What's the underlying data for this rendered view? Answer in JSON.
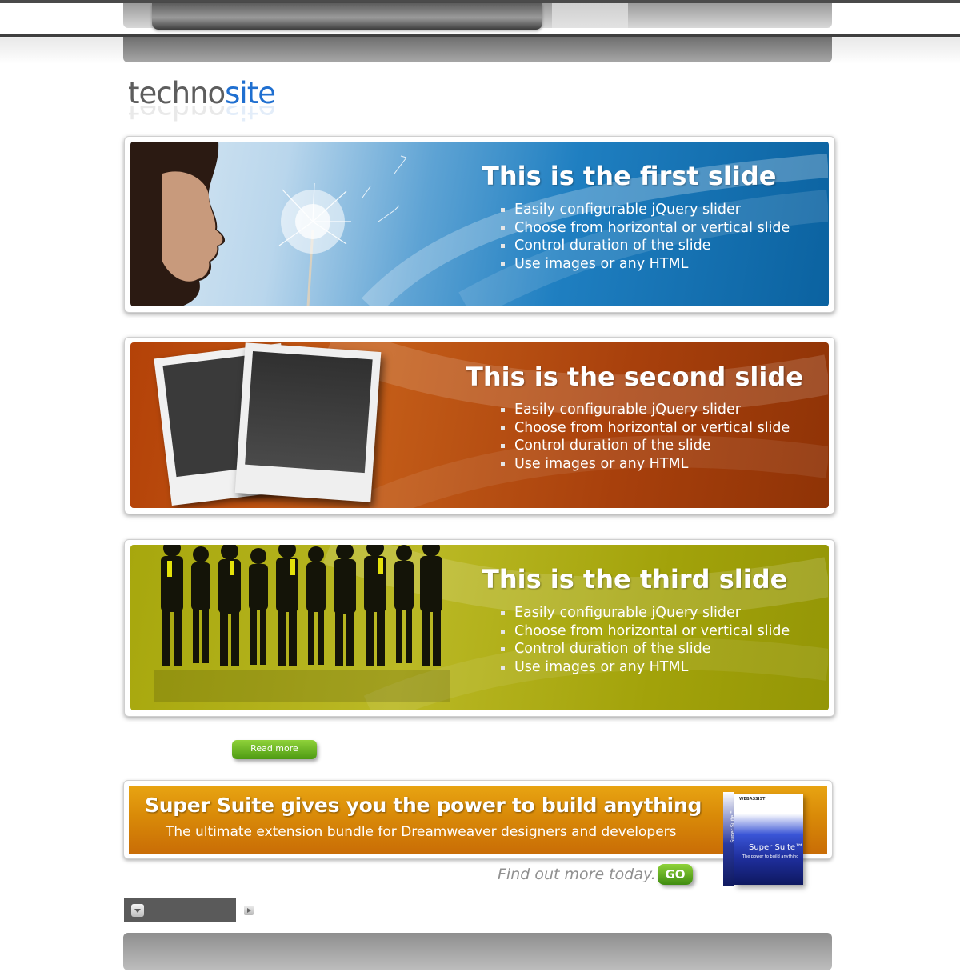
{
  "logo": {
    "part1": "techno",
    "part2": "site"
  },
  "slides": [
    {
      "title": "This is the first slide",
      "bullets": [
        "Easily configurable jQuery slider",
        "Choose from horizontal or vertical slide",
        "Control duration of the slide",
        "Use images or any HTML"
      ],
      "color": "#1274b0"
    },
    {
      "title": "This is the second slide",
      "bullets": [
        "Easily configurable jQuery slider",
        "Choose from horizontal or vertical slide",
        "Control duration of the slide",
        "Use images or any HTML"
      ],
      "color": "#b2470a"
    },
    {
      "title": "This is the third slide",
      "bullets": [
        "Easily configurable jQuery slider",
        "Choose from horizontal or vertical slide",
        "Control duration of the slide",
        "Use images or any HTML"
      ],
      "color": "#a5a60c"
    }
  ],
  "read_more": {
    "label": "Read more"
  },
  "banner": {
    "title": "Super Suite gives you the power to build anything",
    "subtitle": "The ultimate extension bundle for Dreamweaver designers and developers",
    "box_brand": "WEBASSIST",
    "box_side": "Super Suite™",
    "box_title": "Super Suite™",
    "box_tagline": "The power to build anything"
  },
  "find_more": {
    "text": "Find out more today.",
    "button_label": "GO"
  },
  "colors": {
    "accent_green": "#6fb824",
    "brand_blue": "#1f6fd0",
    "banner_orange": "#d98a08"
  }
}
